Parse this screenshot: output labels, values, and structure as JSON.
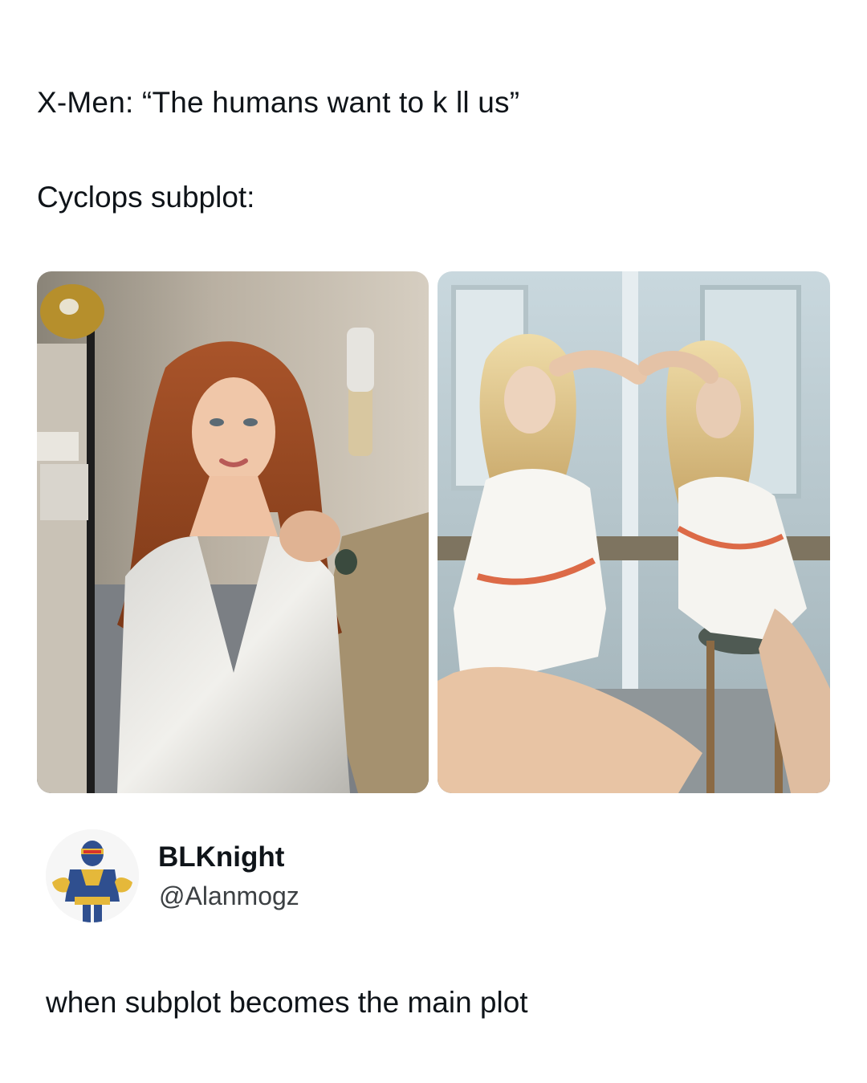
{
  "post": {
    "line1": "X-Men: “The humans want to k ll us”",
    "line2": "Cyclops subplot:"
  },
  "images": [
    {
      "description_icon": "photo-redhead-woman-silver-gown"
    },
    {
      "description_icon": "photo-blonde-woman-white-dress"
    }
  ],
  "reply": {
    "display_name": "BLKnight",
    "handle": "@Alanmogz",
    "text": "when subplot becomes the main plot"
  },
  "colors": {
    "text": "#0f1419",
    "handle": "#3c4043",
    "background": "#ffffff"
  }
}
